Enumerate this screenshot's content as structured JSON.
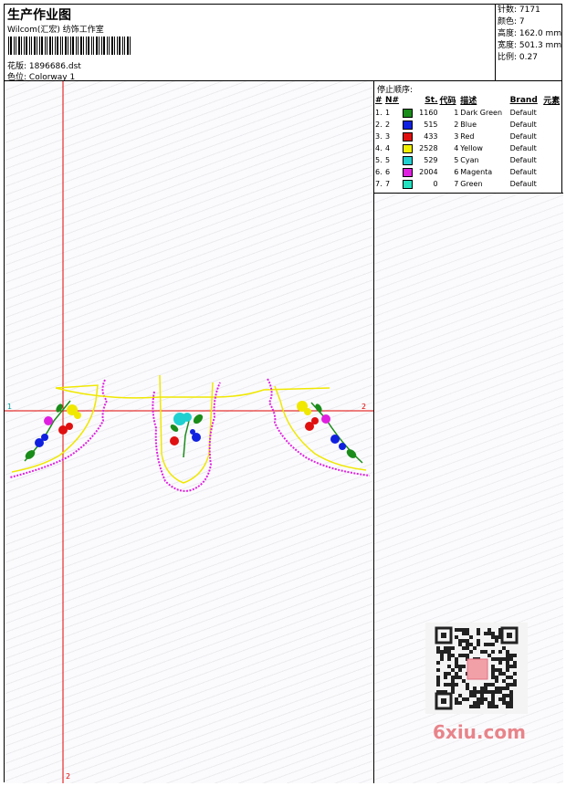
{
  "header": {
    "title": "生产作业图",
    "company": "Wilcom(汇宏) 纺饰工作室",
    "design_label": "花版:",
    "design_value": "1896686.dst",
    "colorway_label": "色位:",
    "colorway_value": "Colorway 1"
  },
  "stats": [
    {
      "label": "针数:",
      "value": "7171"
    },
    {
      "label": "颜色:",
      "value": "7"
    },
    {
      "label": "高度:",
      "value": "162.0 mm"
    },
    {
      "label": "宽度:",
      "value": "501.3 mm"
    },
    {
      "label": "比例:",
      "value": "0.27"
    }
  ],
  "stop_sequence": {
    "title": "停止顺序:",
    "columns": [
      "#",
      "N#",
      "St.",
      "代码",
      "描述",
      "Brand",
      "元素"
    ],
    "rows": [
      {
        "num": "1.",
        "n": "1",
        "st": "1160",
        "code": "1",
        "desc": "Dark Green",
        "brand": "Default",
        "color": "#1a8c1a"
      },
      {
        "num": "2.",
        "n": "2",
        "st": "515",
        "code": "2",
        "desc": "Blue",
        "brand": "Default",
        "color": "#1020e0"
      },
      {
        "num": "3.",
        "n": "3",
        "st": "433",
        "code": "3",
        "desc": "Red",
        "brand": "Default",
        "color": "#e01010"
      },
      {
        "num": "4.",
        "n": "4",
        "st": "2528",
        "code": "4",
        "desc": "Yellow",
        "brand": "Default",
        "color": "#f0f000"
      },
      {
        "num": "5.",
        "n": "5",
        "st": "529",
        "code": "5",
        "desc": "Cyan",
        "brand": "Default",
        "color": "#20d0d0"
      },
      {
        "num": "6.",
        "n": "6",
        "st": "2004",
        "code": "6",
        "desc": "Magenta",
        "brand": "Default",
        "color": "#e020e0"
      },
      {
        "num": "7.",
        "n": "7",
        "st": "0",
        "code": "7",
        "desc": "Green",
        "brand": "Default",
        "color": "#20e0c0"
      }
    ]
  },
  "axis_labels": {
    "h_start": "1",
    "h_end": "2",
    "v_end": "2"
  },
  "watermark": "6xiu.com"
}
